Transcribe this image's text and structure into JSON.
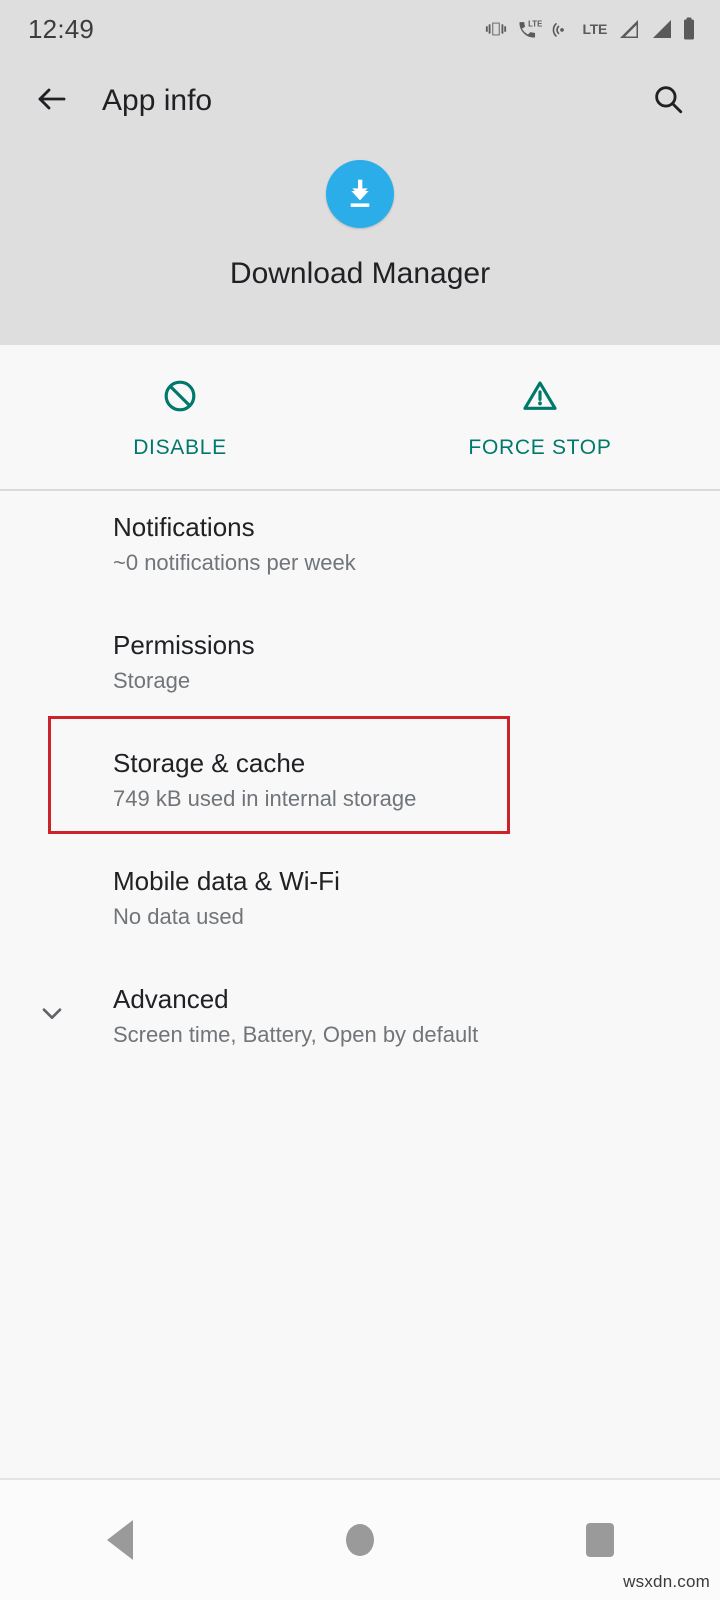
{
  "status_bar": {
    "time": "12:49",
    "icons": [
      "vibrate-icon",
      "phone-lte-icon",
      "hotspot-icon",
      "lte-label",
      "signal-bars-1-icon",
      "signal-bars-2-icon",
      "battery-icon"
    ],
    "lte_label": "LTE"
  },
  "app_bar": {
    "back_icon": "arrow-back-icon",
    "title": "App info",
    "search_icon": "search-icon"
  },
  "app_header": {
    "icon_name": "download-manager-icon",
    "icon_color": "#2badea",
    "app_name": "Download Manager"
  },
  "actions": [
    {
      "label": "DISABLE",
      "icon": "block-circle-slash-icon",
      "color": "#00796b"
    },
    {
      "label": "FORCE STOP",
      "icon": "warning-triangle-icon",
      "color": "#00796b"
    }
  ],
  "settings_rows": [
    {
      "title": "Notifications",
      "subtitle": "~0 notifications per week",
      "chevron": false
    },
    {
      "title": "Permissions",
      "subtitle": "Storage",
      "chevron": false
    },
    {
      "title": "Storage & cache",
      "subtitle": "749 kB used in internal storage",
      "chevron": false,
      "highlighted": true
    },
    {
      "title": "Mobile data & Wi-Fi",
      "subtitle": "No data used",
      "chevron": false
    },
    {
      "title": "Advanced",
      "subtitle": "Screen time, Battery, Open by default",
      "chevron": true
    }
  ],
  "highlight": {
    "color": "#cc2229"
  },
  "nav_bar": {
    "back": "nav-back-icon",
    "home": "nav-home-icon",
    "recents": "nav-recents-icon"
  },
  "watermark": "wsxdn.com"
}
